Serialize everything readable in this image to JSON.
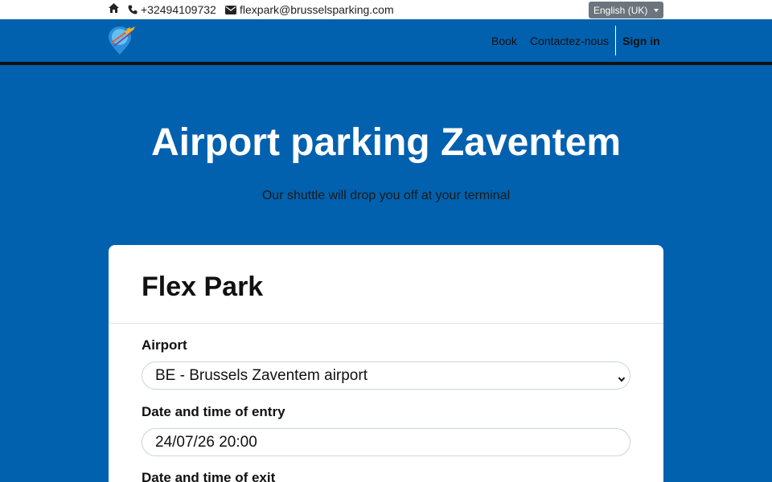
{
  "topbar": {
    "home_icon": "home-icon",
    "phone_icon": "phone-icon",
    "phone": "+32494109732",
    "email_icon": "envelope-icon",
    "email": "flexpark@brusselsparking.com",
    "language": "English (UK)"
  },
  "nav": {
    "logo_icon": "airplane-pin-logo",
    "links": [
      "Book",
      "Contactez-nous",
      "Sign in"
    ]
  },
  "hero": {
    "title": "Airport parking Zaventem",
    "subtitle": "Our shuttle will drop you off at your terminal"
  },
  "form": {
    "title": "Flex Park",
    "airport_label": "Airport",
    "airport_value": "BE - Brussels Zaventem airport",
    "entry_label": "Date and time of entry",
    "entry_value": "24/07/26 20:00",
    "exit_label": "Date and time of exit"
  },
  "colors": {
    "brand_blue": "#0161ae",
    "nav_line": "#111111",
    "language_button": "#6c757d",
    "card": "#ffffff"
  }
}
